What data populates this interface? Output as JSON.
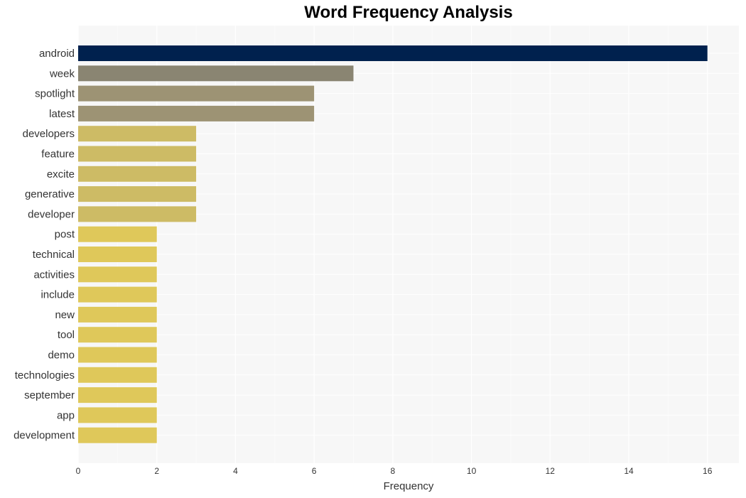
{
  "chart_data": {
    "type": "bar",
    "orientation": "horizontal",
    "title": "Word Frequency Analysis",
    "xlabel": "Frequency",
    "ylabel": "",
    "xlim": [
      0,
      16.8
    ],
    "xticks": [
      0,
      2,
      4,
      6,
      8,
      10,
      12,
      14,
      16
    ],
    "grid": true,
    "categories": [
      "android",
      "week",
      "spotlight",
      "latest",
      "developers",
      "feature",
      "excite",
      "generative",
      "developer",
      "post",
      "technical",
      "activities",
      "include",
      "new",
      "tool",
      "demo",
      "technologies",
      "september",
      "app",
      "development"
    ],
    "values": [
      16,
      7,
      6,
      6,
      3,
      3,
      3,
      3,
      3,
      2,
      2,
      2,
      2,
      2,
      2,
      2,
      2,
      2,
      2,
      2
    ],
    "colors": [
      "#00214e",
      "#8a8572",
      "#9d9374",
      "#9d9374",
      "#cdbb65",
      "#cdbb65",
      "#cdbb65",
      "#cdbb65",
      "#cdbb65",
      "#dfc85a",
      "#dfc85a",
      "#dfc85a",
      "#dfc85a",
      "#dfc85a",
      "#dfc85a",
      "#dfc85a",
      "#dfc85a",
      "#dfc85a",
      "#dfc85a",
      "#dfc85a"
    ]
  }
}
